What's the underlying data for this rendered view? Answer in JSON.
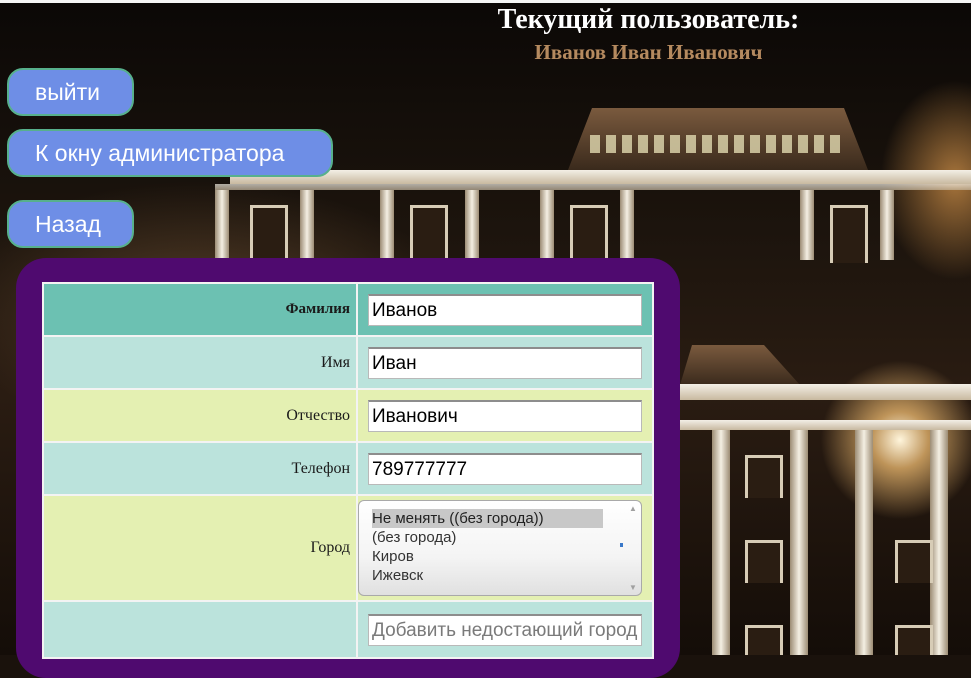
{
  "header": {
    "title": "Текущий пользователь:",
    "user_name": "Иванов Иван Иванович"
  },
  "buttons": {
    "exit": "выйти",
    "admin": "К окну администратора",
    "back": "Назад"
  },
  "form": {
    "surname": {
      "label": "Фамилия",
      "value": "Иванов"
    },
    "name": {
      "label": "Имя",
      "value": "Иван"
    },
    "patronymic": {
      "label": "Отчество",
      "value": "Иванович"
    },
    "phone": {
      "label": "Телефон",
      "value": "789777777"
    },
    "city": {
      "label": "Город",
      "options": [
        "Не менять ((без города))",
        "(без города)",
        "Киров",
        "Ижевск"
      ],
      "selected": "Не менять ((без города))"
    },
    "add_city": {
      "placeholder": "Добавить недостающий город"
    }
  },
  "colors": {
    "button_bg": "#6e8ee6",
    "panel_bg": "#4f0a6f",
    "row_header": "#6cc1b2",
    "row_blue": "#bbe3dc",
    "row_yellow": "#e4f0b2",
    "user_name": "#b58a5f"
  }
}
